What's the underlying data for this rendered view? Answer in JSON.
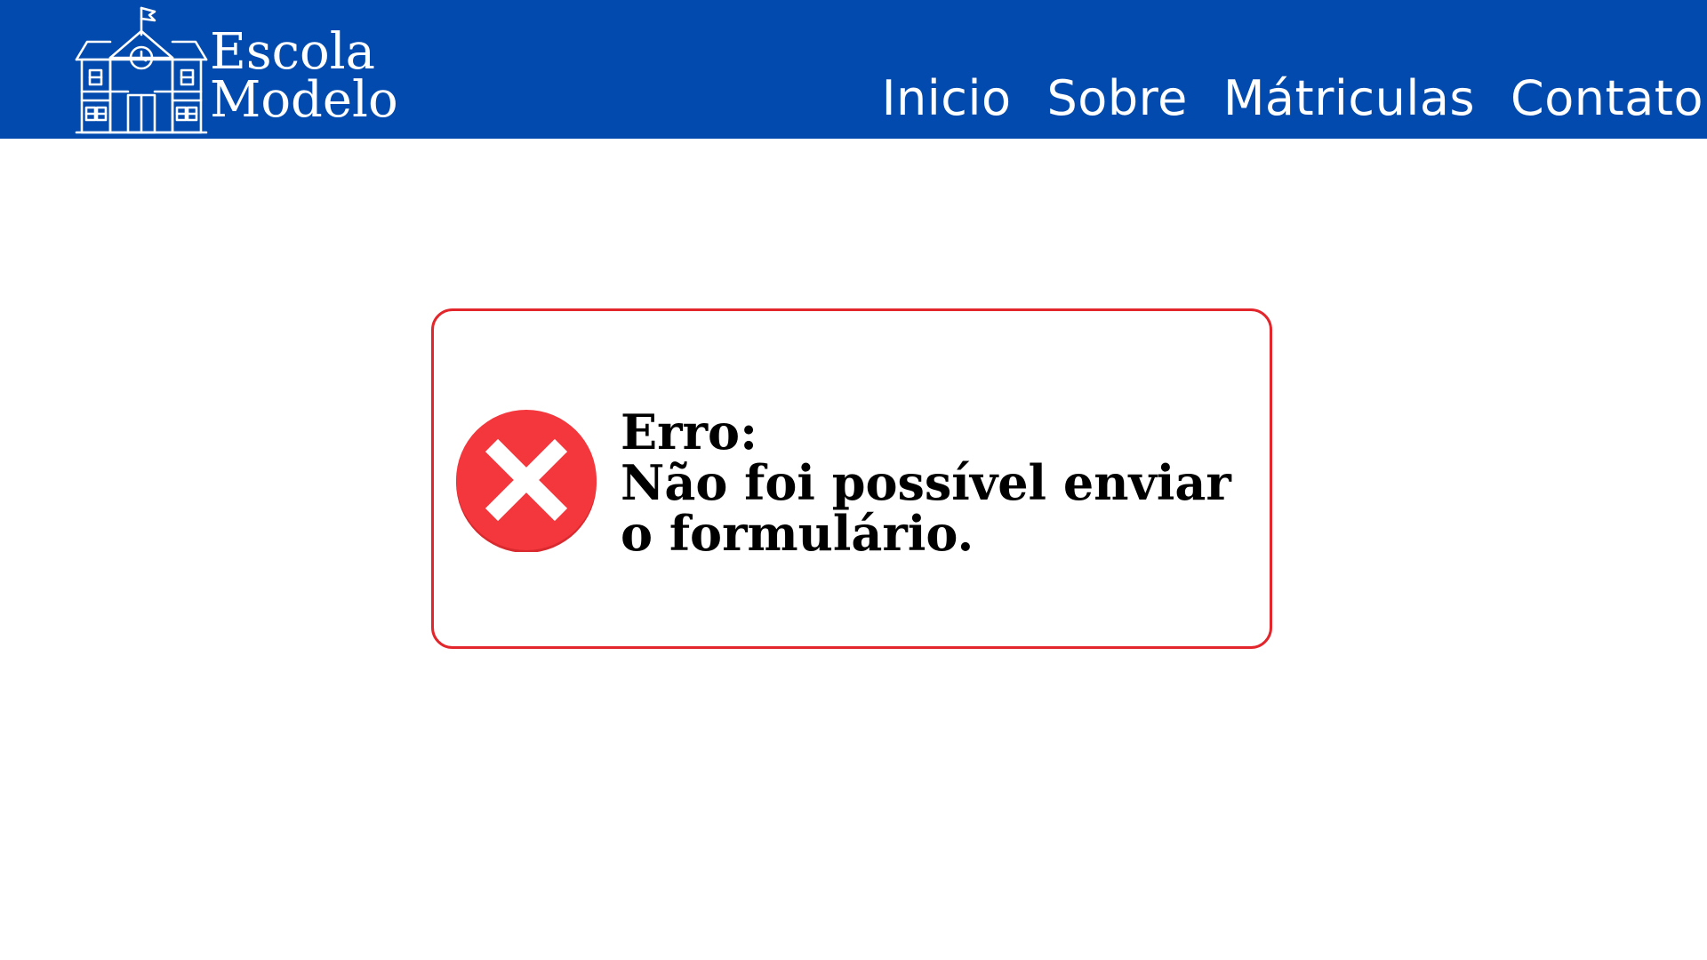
{
  "brand": {
    "line1": "Escola",
    "line2": "Modelo",
    "icon": "school-building-icon"
  },
  "nav": {
    "items": [
      {
        "label": "Inicio"
      },
      {
        "label": "Sobre"
      },
      {
        "label": "Mátriculas"
      },
      {
        "label": "Contato"
      }
    ]
  },
  "error": {
    "title": "Erro:",
    "message": "Não foi possível enviar o formulário.",
    "icon": "error-x-icon",
    "border_color": "#e3262b",
    "icon_color": "#f3373d"
  },
  "colors": {
    "header_bg": "#024aae",
    "page_bg": "#ffffff"
  }
}
